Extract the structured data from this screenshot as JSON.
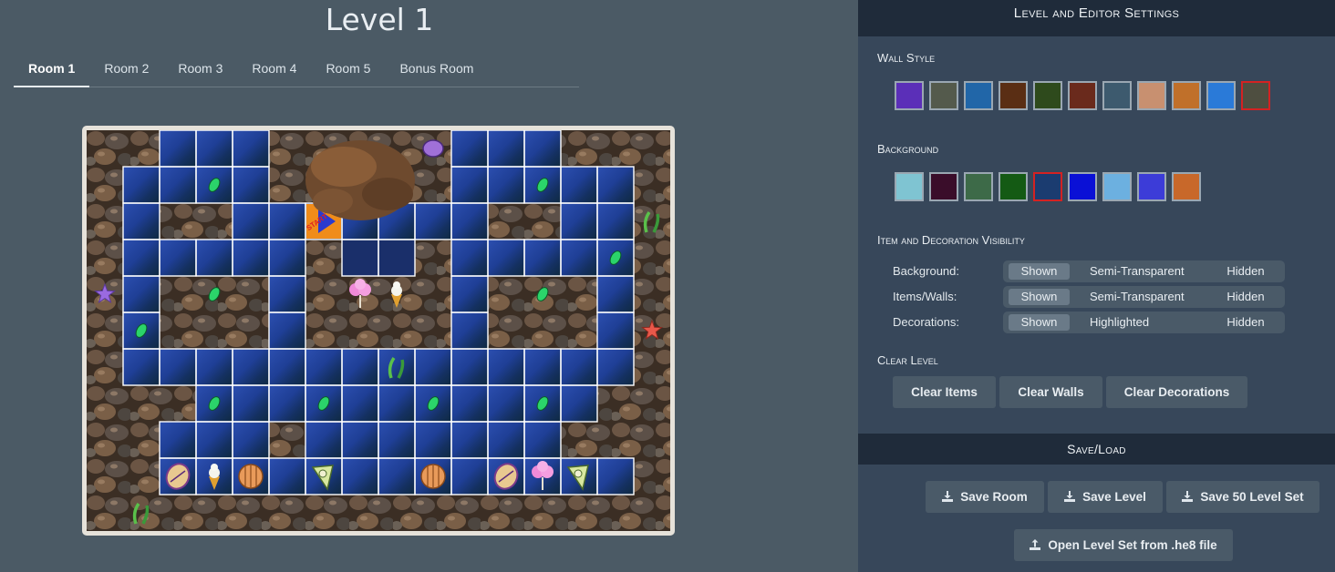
{
  "editor": {
    "level_title": "Level 1",
    "tabs": [
      {
        "label": "Room 1",
        "active": true
      },
      {
        "label": "Room 2",
        "active": false
      },
      {
        "label": "Room 3",
        "active": false
      },
      {
        "label": "Room 4",
        "active": false
      },
      {
        "label": "Room 5",
        "active": false
      },
      {
        "label": "Bonus Room",
        "active": false
      }
    ],
    "board": {
      "cols": 16,
      "rows": 11,
      "open_cells": [
        "..WWW.....WWW...",
        ".WWWW.....WWWWW.",
        ".W..WWSWWWW..WW.",
        ".WWWWW.II.WWWWW.",
        ".W...W....W...W.",
        ".W...W....W...W.",
        ".WWWWWWWWWWWWWW.",
        "...WWWWWWWWWWW..",
        "..WWW.WWWWWWW...",
        "..WWWWWWWWWWWWW.",
        "................"
      ],
      "start_cell_label": "START",
      "items": [
        {
          "type": "leaf",
          "col": 3,
          "row": 1
        },
        {
          "type": "leaf",
          "col": 12,
          "row": 1
        },
        {
          "type": "leaf",
          "col": 14,
          "row": 3
        },
        {
          "type": "leaf",
          "col": 3,
          "row": 4
        },
        {
          "type": "leaf",
          "col": 12,
          "row": 4
        },
        {
          "type": "leaf",
          "col": 1,
          "row": 5
        },
        {
          "type": "leaf",
          "col": 3,
          "row": 7
        },
        {
          "type": "leaf",
          "col": 6,
          "row": 7
        },
        {
          "type": "leaf",
          "col": 9,
          "row": 7
        },
        {
          "type": "leaf",
          "col": 12,
          "row": 7
        },
        {
          "type": "cotton-candy",
          "col": 7,
          "row": 4
        },
        {
          "type": "ice-cream",
          "col": 8,
          "row": 4
        },
        {
          "type": "seashell",
          "col": 2,
          "row": 9
        },
        {
          "type": "ice-cream",
          "col": 3,
          "row": 9
        },
        {
          "type": "clam",
          "col": 4,
          "row": 9
        },
        {
          "type": "conch",
          "col": 6,
          "row": 9
        },
        {
          "type": "clam",
          "col": 9,
          "row": 9
        },
        {
          "type": "seashell",
          "col": 11,
          "row": 9
        },
        {
          "type": "cotton-candy",
          "col": 12,
          "row": 9
        },
        {
          "type": "conch",
          "col": 13,
          "row": 9
        }
      ],
      "decorations": [
        {
          "type": "purple-shell",
          "col": 9,
          "row": 0
        },
        {
          "type": "purple-starfish",
          "col": 0,
          "row": 4
        },
        {
          "type": "red-starfish",
          "col": 15,
          "row": 5
        },
        {
          "type": "seaweed",
          "col": 15,
          "row": 2
        },
        {
          "type": "seaweed",
          "col": 8,
          "row": 6
        },
        {
          "type": "seaweed",
          "col": 1,
          "row": 10
        }
      ]
    }
  },
  "settings": {
    "header": "Level and Editor Settings",
    "wall_style": {
      "label": "Wall Style",
      "swatches": [
        "#5b2fb8",
        "#545a4c",
        "#2166a8",
        "#5a2e14",
        "#2e4a1c",
        "#6a2a1c",
        "#3d5a6e",
        "#c89070",
        "#c0702a",
        "#2a7ad8",
        "#4e4e40"
      ],
      "selected_index": 10
    },
    "background": {
      "label": "Background",
      "swatches": [
        "#7fc4d2",
        "#3a0d2a",
        "#3d6a48",
        "#145a14",
        "#1b3c70",
        "#0a10d6",
        "#6cb0e0",
        "#3c3cd8",
        "#c8682a"
      ],
      "selected_index": 4
    },
    "visibility": {
      "label": "Item and Decoration Visibility",
      "rows": [
        {
          "label": "Background:",
          "options": [
            "Shown",
            "Semi-Transparent",
            "Hidden"
          ],
          "selected": 0
        },
        {
          "label": "Items/Walls:",
          "options": [
            "Shown",
            "Semi-Transparent",
            "Hidden"
          ],
          "selected": 0
        },
        {
          "label": "Decorations:",
          "options": [
            "Shown",
            "Highlighted",
            "Hidden"
          ],
          "selected": 0
        }
      ]
    },
    "clear_level": {
      "label": "Clear Level",
      "buttons": [
        "Clear Items",
        "Clear Walls",
        "Clear Decorations"
      ]
    }
  },
  "save_load": {
    "header": "Save/Load",
    "buttons": [
      "Save Room",
      "Save Level",
      "Save 50 Level Set"
    ],
    "open_button": "Open Level Set from .he8 file"
  }
}
